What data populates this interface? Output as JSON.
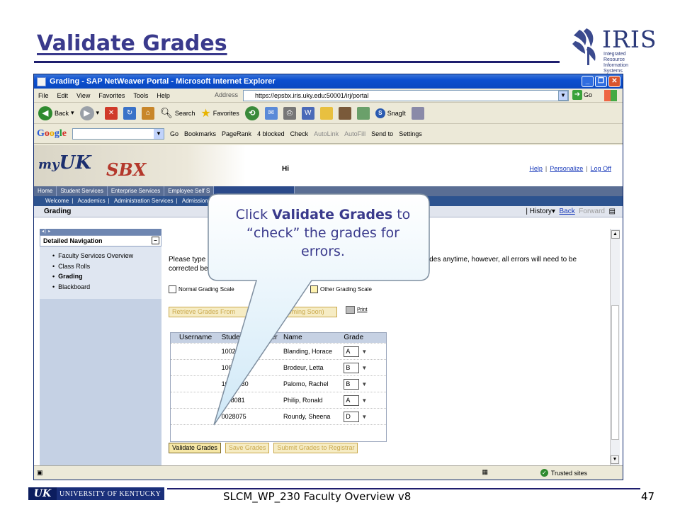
{
  "slide": {
    "title": "Validate Grades",
    "footer": "SLCM_WP_230 Faculty Overview v8",
    "page_number": "47",
    "uk_logo_mark": "UK",
    "uk_logo_name": "UNIVERSITY OF KENTUCKY",
    "iris_logo_text": "IRIS",
    "iris_logo_sub": "Integrated Resource Information Systems"
  },
  "browser": {
    "title": "Grading - SAP NetWeaver Portal - Microsoft Internet Explorer",
    "menu": [
      "File",
      "Edit",
      "View",
      "Favorites",
      "Tools",
      "Help"
    ],
    "address_label": "Address",
    "address": "https://epsbx.iris.uky.edu:50001/irj/portal",
    "go_label": "Go",
    "toolbar": {
      "back": "Back",
      "search": "Search",
      "favorites": "Favorites",
      "snagit": "SnagIt"
    },
    "google_toolbar": {
      "logo": "Google",
      "go": "Go",
      "bookmarks": "Bookmarks",
      "pagerank": "PageRank",
      "blocked": "4 blocked",
      "check": "Check",
      "autolink": "AutoLink",
      "autofill": "AutoFill",
      "send_to": "Send to",
      "settings": "Settings"
    },
    "status": {
      "zone": "Trusted sites"
    }
  },
  "portal": {
    "logo_my": "my",
    "logo_uk": "UK",
    "logo_sbx": "SBX",
    "greeting": "Hi",
    "links": [
      "Help",
      "Personalize",
      "Log Off"
    ],
    "tabs": [
      "Home",
      "Student Services",
      "Enterprise Services",
      "Employee Self S"
    ],
    "subnav": [
      "Welcome",
      "Academics",
      "Administration Services",
      "Admission"
    ],
    "page_title": "Grading",
    "history": {
      "history": "History",
      "back": "Back",
      "forward": "Forward"
    },
    "detailed_nav": {
      "title": "Detailed Navigation",
      "items": [
        "Faculty Services Overview",
        "Class Rolls",
        "Grading",
        "Blackboard"
      ],
      "current": "Grading"
    },
    "instructions_start": "Please type or s",
    "instructions_end": "rades anytime, however, all errors will need to be",
    "instructions_line2": "corrected before",
    "scale_normal": "Normal Grading Scale",
    "scale_other": "Other Grading Scale",
    "retrieve_label": "Retrieve Grades From",
    "retrieve_suffix": "(Coming Soon)",
    "print_label": "Print",
    "grid": {
      "headers": [
        "Username",
        "Stude",
        "er",
        "Name",
        "Grade"
      ],
      "rows": [
        {
          "student": "1002",
          "name": "Blanding, Horace",
          "grade": "A"
        },
        {
          "student": "100",
          "name": "Brodeur, Letta",
          "grade": "B"
        },
        {
          "student": "10",
          "student_tail": "30",
          "name": "Palomo, Rachel",
          "grade": "B"
        },
        {
          "student": "1",
          "student_tail": "8081",
          "name": "Philip, Ronald",
          "grade": "A"
        },
        {
          "student": "0028075",
          "name": "Roundy, Sheena",
          "grade": "D"
        }
      ]
    },
    "buttons": {
      "validate": "Validate Grades",
      "save": "Save Grades",
      "submit": "Submit Grades to Registrar"
    }
  },
  "callout": {
    "prefix": "Click ",
    "bold": "Validate Grades",
    "suffix": " to “check” the grades for errors."
  }
}
